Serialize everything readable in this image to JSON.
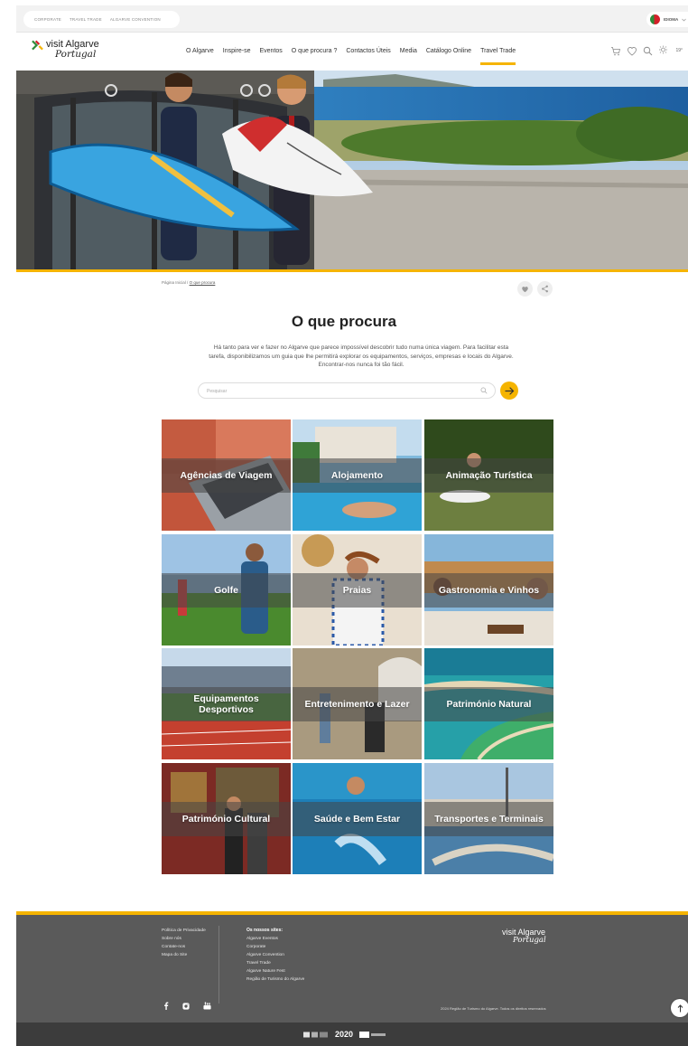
{
  "topbar": {
    "links": [
      "CORPORATE",
      "TRAVEL TRADE",
      "ALGARVE CONVENTION"
    ],
    "language_label": "IDIOMA"
  },
  "brand": {
    "logo_line1_light": "visit",
    "logo_line1_bold": "Algarve",
    "logo_line2": "Portugal"
  },
  "nav": {
    "items": [
      "O Algarve",
      "Inspire-se",
      "Eventos",
      "O que procura ?",
      "Contactos Úteis",
      "Media",
      "Catálogo Online",
      "Travel Trade"
    ],
    "active_index": 7,
    "weather_temp": "19°"
  },
  "breadcrumb": {
    "home": "Página Inicial",
    "separator": "/",
    "current": "O que procura"
  },
  "main": {
    "title": "O que procura",
    "intro": "Há tanto para ver e fazer no Algarve que parece impossível descobrir tudo numa única viagem. Para facilitar esta tarefa, disponibilizamos um guia que lhe permitirá explorar os equipamentos, serviços, empresas e locais do Algarve. Encontrar-nos nunca foi tão fácil.",
    "search_placeholder": "Pesquisar"
  },
  "categories": [
    {
      "label": "Agências de Viagem"
    },
    {
      "label": "Alojamento"
    },
    {
      "label": "Animação Turística"
    },
    {
      "label": "Golfe"
    },
    {
      "label": "Praias"
    },
    {
      "label": "Gastronomia e Vinhos"
    },
    {
      "label": "Equipamentos Desportivos"
    },
    {
      "label": "Entretenimento e Lazer"
    },
    {
      "label": "Património Natural"
    },
    {
      "label": "Património Cultural"
    },
    {
      "label": "Saúde e Bem Estar"
    },
    {
      "label": "Transportes e Terminais"
    }
  ],
  "footer": {
    "col1": [
      "Política de Privacidade",
      "Sobre nós",
      "Contate-nos",
      "Mapa do Site"
    ],
    "col2_title": "Os nossos sites:",
    "col2": [
      "Algarve Eventos",
      "Corporate",
      "Algarve Convention",
      "Travel Trade",
      "Algarve Nature Fest",
      "Região de Turismo do Algarve"
    ],
    "logo_line1": "visit Algarve",
    "logo_line2": "Portugal",
    "copyright": "2024 Região de Turismo do Algarve. Todos os direitos reservados",
    "partner_2020": "2020"
  },
  "colors": {
    "accent": "#f5b400",
    "footer_bg": "#5a5a5a",
    "bottom_bar": "#3c3c3c"
  }
}
